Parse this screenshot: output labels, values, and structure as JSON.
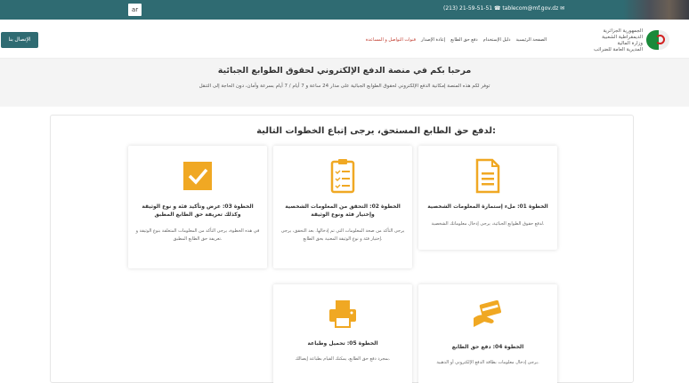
{
  "topbar": {
    "lang_label": "ar",
    "contact": "(213) 21-59-51-51 ☎    tablecom@mf.gov.dz ✉"
  },
  "header": {
    "login_label": "الإتصال بنا",
    "nav": [
      {
        "label": "الصفحة الرئيسية",
        "active": false
      },
      {
        "label": "دليل الإستخدام",
        "active": false
      },
      {
        "label": "دفع حق الطابع",
        "active": false
      },
      {
        "label": "إعادة الإصدار",
        "active": false
      },
      {
        "label": "قنوات التواصل و المساعدة",
        "active": true
      }
    ],
    "logo_text": [
      "الجمهورية الجزائرية الديمقراطية الشعبية",
      "وزارة المالية",
      "المديرية العامة للضرائب"
    ]
  },
  "hero": {
    "title": "مرحبا بكم في منصة الدفع الإلكتروني لحقوق الطوابع الجبائية",
    "subtitle": "توفر لكم هذه المنصة إمكانية الدفع الإلكتروني لحقوق الطوابع الجبائية على مدار 24 ساعة و 7 أيام / 7 أيام بسرعة وأمان، دون الحاجة إلى التنقل"
  },
  "steps_title": "لدفع حق الطابع المستحق، يرجى إتباع الخطوات التالية:",
  "steps": [
    {
      "title": "الخطوة 01: ملء إستمارة المعلومات الشخصية",
      "desc": "لدفع حقوق الطوابع الجبائية، يرجى إدخال معلوماتك الشخصية.",
      "icon": "document-icon"
    },
    {
      "title": "الخطوة 02: التحقق من المعلومات الشخصية وإختيار فئة ونوع الوثيقة",
      "desc": "يرجى التأكد من صحة المعلومات التي تم إدخالها. بعد التحقق، يرجى إختيار فئة و نوع الوثيقة المعنية بحق الطابع.",
      "icon": "checklist-icon"
    },
    {
      "title": "الخطوة 03: عرض وتأكيد فئة و نوع الوثيقة وكذلك تعريفة حق الطابع المطبق",
      "desc": "في هذه الخطوة، يرجى التأكد من المعلومات المتعلقة بنوع الوثيقة و تعريفة حق الطابع المطبق.",
      "icon": "checkbox-icon"
    },
    {
      "title": "الخطوة 04: دفع حق الطابع",
      "desc": "يرجى إدخال معلومات بطاقة الدفع الإلكتروني أو الذهبية.",
      "icon": "card-payment-icon"
    },
    {
      "title": "الخطوة 05: تحميل وطباعة",
      "desc": "بمجرد دفع حق الطابع، يمكنك القيام بطباعة إيصالك.",
      "icon": "printer-icon"
    }
  ],
  "colors": {
    "brand": "#2f6b72",
    "accent": "#f0a823",
    "active_nav": "#c0392b"
  }
}
